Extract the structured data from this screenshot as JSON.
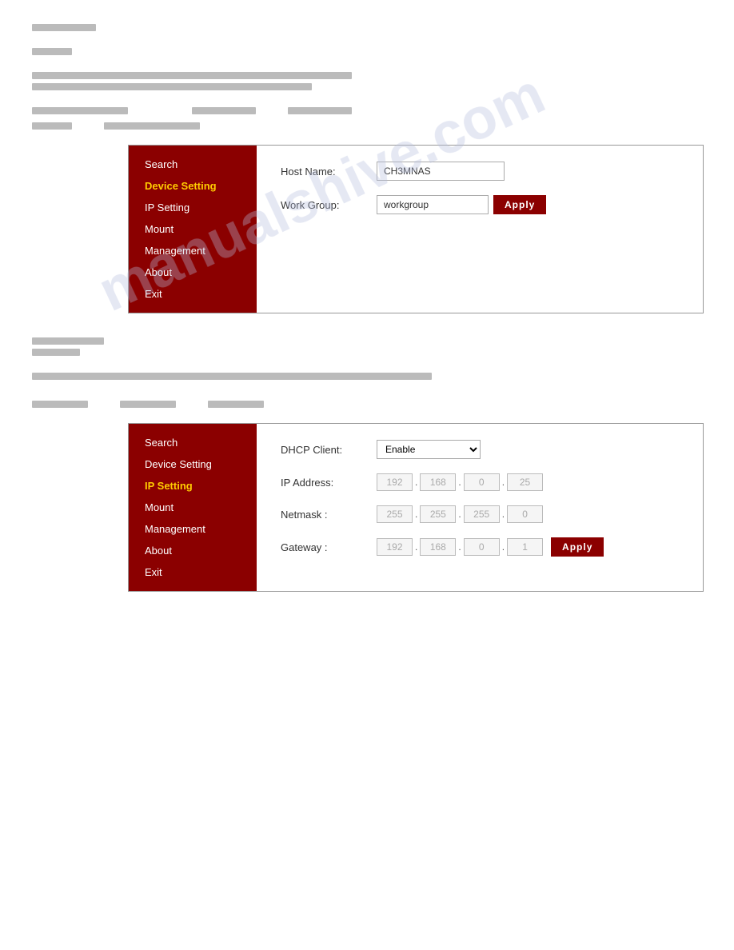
{
  "watermark": "manualshive.com",
  "panel1": {
    "sidebar": {
      "items": [
        {
          "label": "Search",
          "active": false
        },
        {
          "label": "Device Setting",
          "active": true
        },
        {
          "label": "IP Setting",
          "active": false
        },
        {
          "label": "Mount",
          "active": false
        },
        {
          "label": "Management",
          "active": false
        },
        {
          "label": "About",
          "active": false
        },
        {
          "label": "Exit",
          "active": false
        }
      ]
    },
    "form": {
      "hostname_label": "Host Name:",
      "hostname_value": "CH3MNAS",
      "workgroup_label": "Work Group:",
      "workgroup_value": "workgroup",
      "apply_label": "Apply"
    }
  },
  "panel2": {
    "sidebar": {
      "items": [
        {
          "label": "Search",
          "active": false
        },
        {
          "label": "Device Setting",
          "active": false
        },
        {
          "label": "IP Setting",
          "active": true
        },
        {
          "label": "Mount",
          "active": false
        },
        {
          "label": "Management",
          "active": false
        },
        {
          "label": "About",
          "active": false
        },
        {
          "label": "Exit",
          "active": false
        }
      ]
    },
    "form": {
      "dhcp_label": "DHCP Client",
      "dhcp_value": "Enable",
      "ip_label": "IP Address",
      "ip_parts": [
        "192",
        "168",
        "0",
        "25"
      ],
      "netmask_label": "Netmask :",
      "netmask_parts": [
        "255",
        "255",
        "255",
        "0"
      ],
      "gateway_label": "Gateway :",
      "gateway_parts": [
        "192",
        "168",
        "0",
        "1"
      ],
      "apply_label": "Apply"
    }
  }
}
